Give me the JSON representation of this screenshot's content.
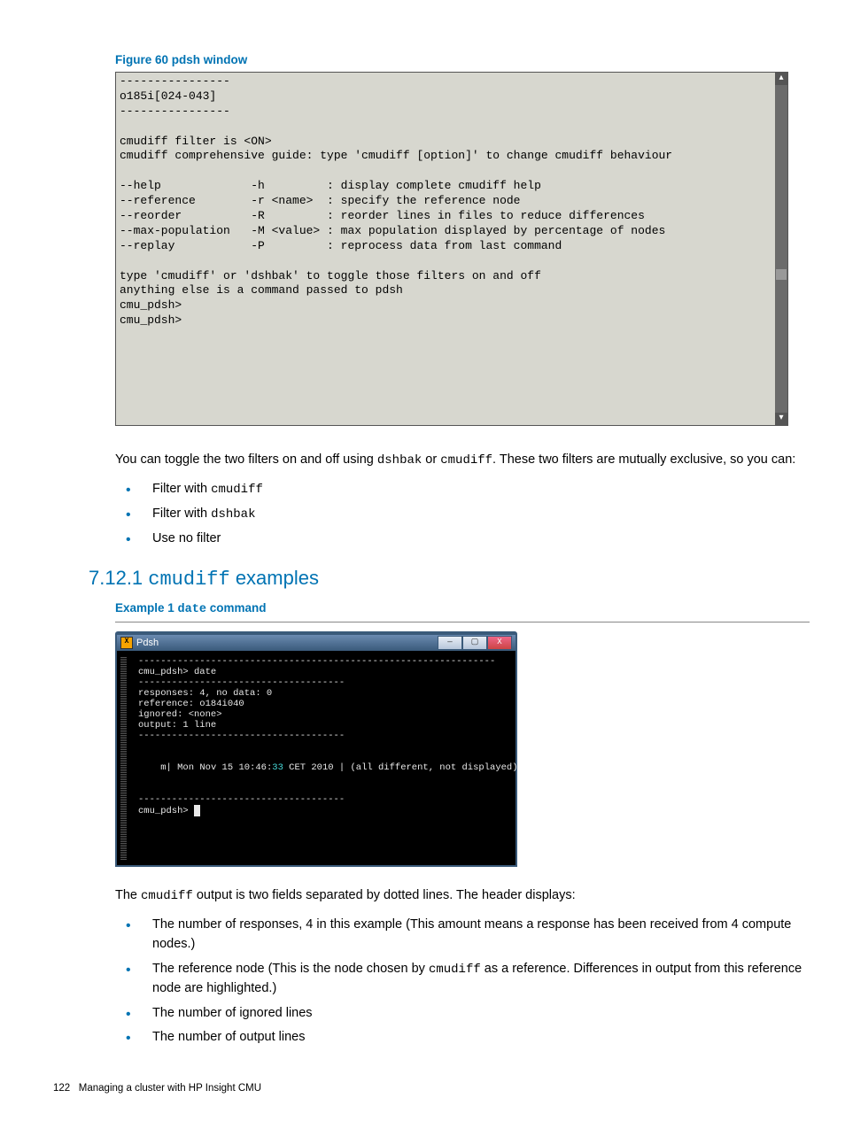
{
  "figure": {
    "caption": "Figure 60 pdsh window",
    "terminal": "----------------\no185i[024-043]\n----------------\n\ncmudiff filter is <ON>\ncmudiff comprehensive guide: type 'cmudiff [option]' to change cmudiff behaviour\n\n--help             -h         : display complete cmudiff help\n--reference        -r <name>  : specify the reference node\n--reorder          -R         : reorder lines in files to reduce differences\n--max-population   -M <value> : max population displayed by percentage of nodes\n--replay           -P         : reprocess data from last command\n\ntype 'cmudiff' or 'dshbak' to toggle those filters on and off\nanything else is a command passed to pdsh\ncmu_pdsh> \ncmu_pdsh>"
  },
  "para1": {
    "p1a": "You can toggle the two filters on and off using ",
    "c1": "dshbak",
    "p1b": " or ",
    "c2": "cmudiff",
    "p1c": ". These two filters are mutually exclusive, so you can:"
  },
  "bullets1": {
    "b1a": "Filter with ",
    "b1c": "cmudiff",
    "b2a": "Filter with ",
    "b2c": "dshbak",
    "b3": "Use no filter"
  },
  "section": {
    "num": "7.12.1 ",
    "code": "cmudiff",
    "rest": " examples"
  },
  "example": {
    "pre": "Example 1 ",
    "code": "date",
    "post": " command"
  },
  "pdsh_window": {
    "title": "Pdsh",
    "line_dash_long": "----------------------------------------------------------------",
    "line_cmd": "cmu_pdsh> date",
    "line_dash_short": "-------------------------------------",
    "l1": "responses: 4, no data: 0",
    "l2": "reference: o184i040",
    "l3": "ignored: <none>",
    "l4": "output: 1 line",
    "row_m": "m",
    "row_date_a": "| Mon Nov 15 10:46:",
    "row_date_sec": "33",
    "row_date_b": " CET 2010 | (all different, not displayed)",
    "prompt": "cmu_pdsh> "
  },
  "para2": {
    "a": "The ",
    "c": "cmudiff",
    "b": " output is two fields separated by dotted lines. The header displays:"
  },
  "bullets2": {
    "b1": "The number of responses, 4 in this example (This amount means a response has been received from 4 compute nodes.)",
    "b2a": "The reference node (This is the node chosen by ",
    "b2c": "cmudiff",
    "b2b": " as a reference. Differences in output from this reference node are highlighted.)",
    "b3": "The number of ignored lines",
    "b4": "The number of output lines"
  },
  "footer": {
    "page": "122",
    "text": "Managing a cluster with HP Insight CMU"
  }
}
